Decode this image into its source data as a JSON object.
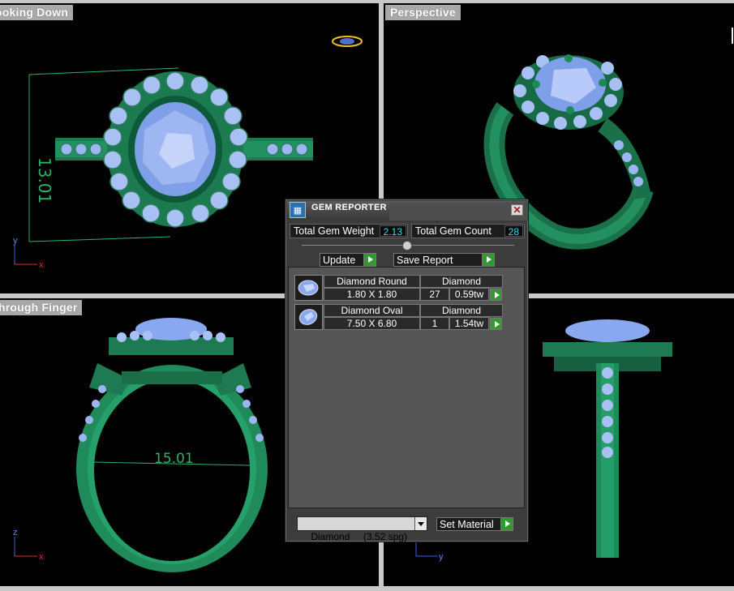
{
  "viewports": {
    "top_label": "ooking Down",
    "perspective_label": "Perspective",
    "front_label": "hrough Finger",
    "top_dimension": "13.01",
    "front_dimension": "15.01",
    "axis_x": "x",
    "axis_y": "y",
    "axis_z": "z"
  },
  "gem_reporter": {
    "title": "GEM REPORTER",
    "close_glyph": "✕",
    "total_weight_label": "Total Gem Weight",
    "total_weight_value": "2.13",
    "total_count_label": "Total Gem Count",
    "total_count_value": "28",
    "update_label": "Update",
    "save_report_label": "Save Report",
    "gems": [
      {
        "name": "Diamond Round",
        "material": "Diamond",
        "size": "1.80 X 1.80",
        "count": "27",
        "weight": "0.59tw"
      },
      {
        "name": "Diamond Oval",
        "material": "Diamond",
        "size": "7.50 X 6.80",
        "count": "1",
        "weight": "1.54tw"
      }
    ],
    "material_select": "Diamond     (3.52 spg)",
    "set_material_label": "Set Material"
  },
  "colors": {
    "metal": "#1f8a5a",
    "gem": "#8aa8f0",
    "accent_value": "#40d8f0",
    "arrow_green": "#2f9a2f"
  }
}
